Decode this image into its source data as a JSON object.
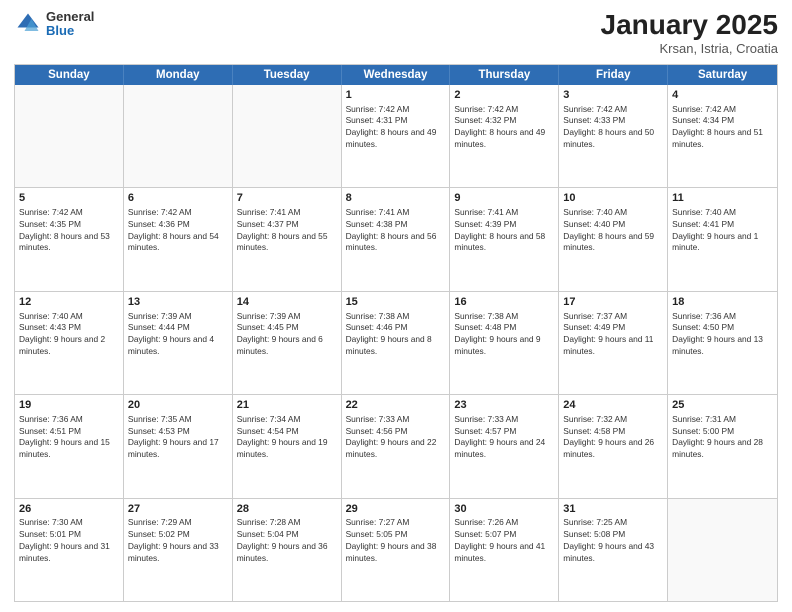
{
  "header": {
    "title": "January 2025",
    "subtitle": "Krsan, Istria, Croatia",
    "logo_general": "General",
    "logo_blue": "Blue"
  },
  "calendar": {
    "days_of_week": [
      "Sunday",
      "Monday",
      "Tuesday",
      "Wednesday",
      "Thursday",
      "Friday",
      "Saturday"
    ],
    "rows": [
      [
        {
          "day": "",
          "empty": true
        },
        {
          "day": "",
          "empty": true
        },
        {
          "day": "",
          "empty": true
        },
        {
          "day": "1",
          "sunrise": "Sunrise: 7:42 AM",
          "sunset": "Sunset: 4:31 PM",
          "daylight": "Daylight: 8 hours and 49 minutes."
        },
        {
          "day": "2",
          "sunrise": "Sunrise: 7:42 AM",
          "sunset": "Sunset: 4:32 PM",
          "daylight": "Daylight: 8 hours and 49 minutes."
        },
        {
          "day": "3",
          "sunrise": "Sunrise: 7:42 AM",
          "sunset": "Sunset: 4:33 PM",
          "daylight": "Daylight: 8 hours and 50 minutes."
        },
        {
          "day": "4",
          "sunrise": "Sunrise: 7:42 AM",
          "sunset": "Sunset: 4:34 PM",
          "daylight": "Daylight: 8 hours and 51 minutes."
        }
      ],
      [
        {
          "day": "5",
          "sunrise": "Sunrise: 7:42 AM",
          "sunset": "Sunset: 4:35 PM",
          "daylight": "Daylight: 8 hours and 53 minutes."
        },
        {
          "day": "6",
          "sunrise": "Sunrise: 7:42 AM",
          "sunset": "Sunset: 4:36 PM",
          "daylight": "Daylight: 8 hours and 54 minutes."
        },
        {
          "day": "7",
          "sunrise": "Sunrise: 7:41 AM",
          "sunset": "Sunset: 4:37 PM",
          "daylight": "Daylight: 8 hours and 55 minutes."
        },
        {
          "day": "8",
          "sunrise": "Sunrise: 7:41 AM",
          "sunset": "Sunset: 4:38 PM",
          "daylight": "Daylight: 8 hours and 56 minutes."
        },
        {
          "day": "9",
          "sunrise": "Sunrise: 7:41 AM",
          "sunset": "Sunset: 4:39 PM",
          "daylight": "Daylight: 8 hours and 58 minutes."
        },
        {
          "day": "10",
          "sunrise": "Sunrise: 7:40 AM",
          "sunset": "Sunset: 4:40 PM",
          "daylight": "Daylight: 8 hours and 59 minutes."
        },
        {
          "day": "11",
          "sunrise": "Sunrise: 7:40 AM",
          "sunset": "Sunset: 4:41 PM",
          "daylight": "Daylight: 9 hours and 1 minute."
        }
      ],
      [
        {
          "day": "12",
          "sunrise": "Sunrise: 7:40 AM",
          "sunset": "Sunset: 4:43 PM",
          "daylight": "Daylight: 9 hours and 2 minutes."
        },
        {
          "day": "13",
          "sunrise": "Sunrise: 7:39 AM",
          "sunset": "Sunset: 4:44 PM",
          "daylight": "Daylight: 9 hours and 4 minutes."
        },
        {
          "day": "14",
          "sunrise": "Sunrise: 7:39 AM",
          "sunset": "Sunset: 4:45 PM",
          "daylight": "Daylight: 9 hours and 6 minutes."
        },
        {
          "day": "15",
          "sunrise": "Sunrise: 7:38 AM",
          "sunset": "Sunset: 4:46 PM",
          "daylight": "Daylight: 9 hours and 8 minutes."
        },
        {
          "day": "16",
          "sunrise": "Sunrise: 7:38 AM",
          "sunset": "Sunset: 4:48 PM",
          "daylight": "Daylight: 9 hours and 9 minutes."
        },
        {
          "day": "17",
          "sunrise": "Sunrise: 7:37 AM",
          "sunset": "Sunset: 4:49 PM",
          "daylight": "Daylight: 9 hours and 11 minutes."
        },
        {
          "day": "18",
          "sunrise": "Sunrise: 7:36 AM",
          "sunset": "Sunset: 4:50 PM",
          "daylight": "Daylight: 9 hours and 13 minutes."
        }
      ],
      [
        {
          "day": "19",
          "sunrise": "Sunrise: 7:36 AM",
          "sunset": "Sunset: 4:51 PM",
          "daylight": "Daylight: 9 hours and 15 minutes."
        },
        {
          "day": "20",
          "sunrise": "Sunrise: 7:35 AM",
          "sunset": "Sunset: 4:53 PM",
          "daylight": "Daylight: 9 hours and 17 minutes."
        },
        {
          "day": "21",
          "sunrise": "Sunrise: 7:34 AM",
          "sunset": "Sunset: 4:54 PM",
          "daylight": "Daylight: 9 hours and 19 minutes."
        },
        {
          "day": "22",
          "sunrise": "Sunrise: 7:33 AM",
          "sunset": "Sunset: 4:56 PM",
          "daylight": "Daylight: 9 hours and 22 minutes."
        },
        {
          "day": "23",
          "sunrise": "Sunrise: 7:33 AM",
          "sunset": "Sunset: 4:57 PM",
          "daylight": "Daylight: 9 hours and 24 minutes."
        },
        {
          "day": "24",
          "sunrise": "Sunrise: 7:32 AM",
          "sunset": "Sunset: 4:58 PM",
          "daylight": "Daylight: 9 hours and 26 minutes."
        },
        {
          "day": "25",
          "sunrise": "Sunrise: 7:31 AM",
          "sunset": "Sunset: 5:00 PM",
          "daylight": "Daylight: 9 hours and 28 minutes."
        }
      ],
      [
        {
          "day": "26",
          "sunrise": "Sunrise: 7:30 AM",
          "sunset": "Sunset: 5:01 PM",
          "daylight": "Daylight: 9 hours and 31 minutes."
        },
        {
          "day": "27",
          "sunrise": "Sunrise: 7:29 AM",
          "sunset": "Sunset: 5:02 PM",
          "daylight": "Daylight: 9 hours and 33 minutes."
        },
        {
          "day": "28",
          "sunrise": "Sunrise: 7:28 AM",
          "sunset": "Sunset: 5:04 PM",
          "daylight": "Daylight: 9 hours and 36 minutes."
        },
        {
          "day": "29",
          "sunrise": "Sunrise: 7:27 AM",
          "sunset": "Sunset: 5:05 PM",
          "daylight": "Daylight: 9 hours and 38 minutes."
        },
        {
          "day": "30",
          "sunrise": "Sunrise: 7:26 AM",
          "sunset": "Sunset: 5:07 PM",
          "daylight": "Daylight: 9 hours and 41 minutes."
        },
        {
          "day": "31",
          "sunrise": "Sunrise: 7:25 AM",
          "sunset": "Sunset: 5:08 PM",
          "daylight": "Daylight: 9 hours and 43 minutes."
        },
        {
          "day": "",
          "empty": true
        }
      ]
    ]
  }
}
